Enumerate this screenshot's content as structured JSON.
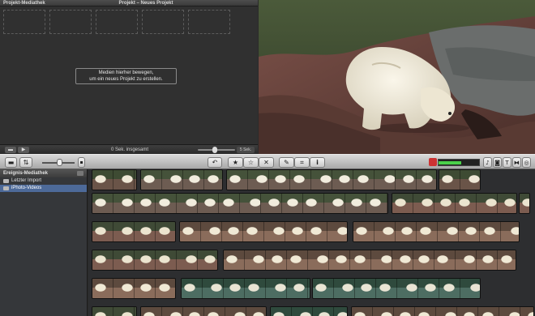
{
  "project_pane": {
    "title_left": "Projekt-Mediathek",
    "title_center": "Projekt – Neues Projekt",
    "drop_hint_line1": "Medien hierher bewegen,",
    "drop_hint_line2": "um ein neues Projekt zu erstellen.",
    "total_duration": "0 Sek. insgesamt",
    "zoom_label": "5 Sek."
  },
  "library": {
    "title": "Ereignis-Mediathek",
    "items": [
      {
        "label": "Letzter Import",
        "selected": false
      },
      {
        "label": "iPhoto-Videos",
        "selected": true
      }
    ]
  },
  "toolbar": {
    "buttons_center": [
      {
        "icon": "undo-icon",
        "glyph": "↶"
      },
      {
        "icon": "star-filled-icon",
        "glyph": "★"
      },
      {
        "icon": "star-outline-icon",
        "glyph": "☆"
      },
      {
        "icon": "reject-x-icon",
        "glyph": "✕"
      },
      {
        "icon": "eyedropper-icon",
        "glyph": "✎"
      },
      {
        "icon": "crop-icon",
        "glyph": "⌗"
      },
      {
        "icon": "info-icon",
        "glyph": "i"
      }
    ],
    "buttons_right": [
      {
        "icon": "music-browser-icon",
        "glyph": "♪"
      },
      {
        "icon": "photo-browser-icon",
        "glyph": "◙"
      },
      {
        "icon": "title-browser-icon",
        "glyph": "T"
      },
      {
        "icon": "transition-browser-icon",
        "glyph": "⧓"
      },
      {
        "icon": "map-browser-icon",
        "glyph": "◎"
      }
    ],
    "audio_level": 0.55
  },
  "colors": {
    "selection": "#4d6a99",
    "toolbar_gradient_top": "#d9d9d9",
    "toolbar_gradient_bottom": "#a8a8a8",
    "meter_green": "#4ad04a"
  }
}
